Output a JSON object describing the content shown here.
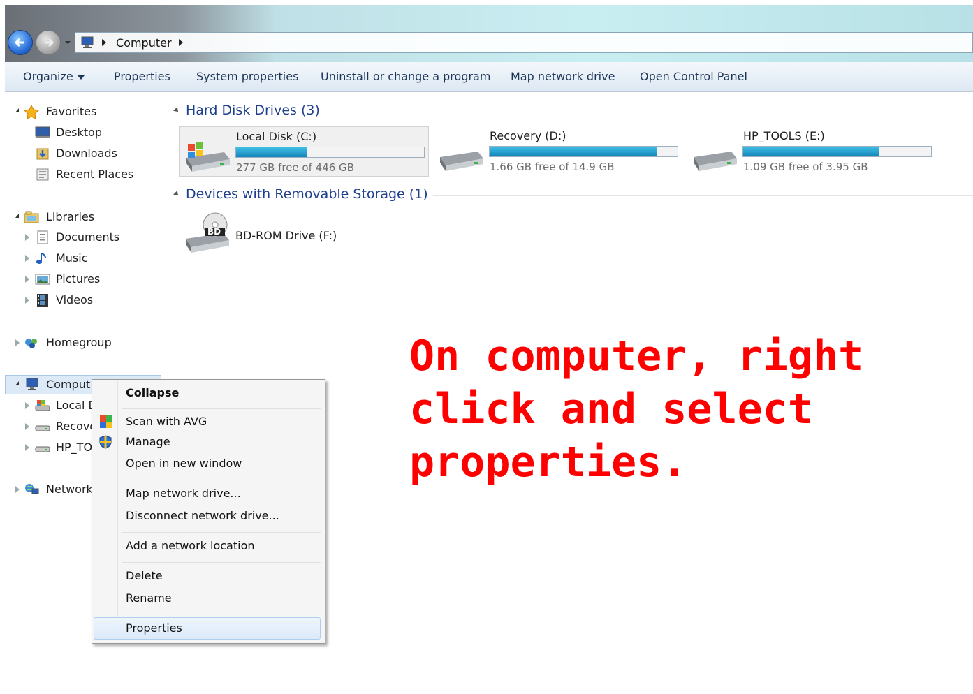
{
  "address": {
    "path": [
      "Computer"
    ]
  },
  "toolbar": {
    "organize": "Organize",
    "properties": "Properties",
    "system_properties": "System properties",
    "uninstall": "Uninstall or change a program",
    "map_drive": "Map network drive",
    "control_panel": "Open Control Panel"
  },
  "nav": {
    "favorites": "Favorites",
    "desktop": "Desktop",
    "downloads": "Downloads",
    "recent": "Recent Places",
    "libraries": "Libraries",
    "documents": "Documents",
    "music": "Music",
    "pictures": "Pictures",
    "videos": "Videos",
    "homegroup": "Homegroup",
    "computer": "Comput",
    "local": "Local D",
    "recovery": "Recove",
    "hptools": "HP_TO",
    "network": "Network"
  },
  "groups": {
    "hdd": "Hard Disk Drives (3)",
    "removable": "Devices with Removable Storage (1)"
  },
  "drives": [
    {
      "name": "Local Disk (C:)",
      "free": "277 GB free of 446 GB",
      "used_fraction": 0.38
    },
    {
      "name": "Recovery (D:)",
      "free": "1.66 GB free of 14.9 GB",
      "used_fraction": 0.89
    },
    {
      "name": "HP_TOOLS (E:)",
      "free": "1.09 GB free of 3.95 GB",
      "used_fraction": 0.72
    }
  ],
  "removable": {
    "name": "BD-ROM Drive (F:)",
    "badge": "BD"
  },
  "context_menu": {
    "collapse": "Collapse",
    "scan": "Scan with AVG",
    "manage": "Manage",
    "open_new": "Open in new window",
    "map": "Map network drive...",
    "disconnect": "Disconnect network drive...",
    "add_location": "Add a network location",
    "delete": "Delete",
    "rename": "Rename",
    "properties": "Properties"
  },
  "annotation": {
    "line1": "On computer, right",
    "line2": "click and select",
    "line3": "properties."
  },
  "colors": {
    "annotation": "#ff0000",
    "link": "#1e3f8f",
    "disk_bar": "#1684b8"
  }
}
